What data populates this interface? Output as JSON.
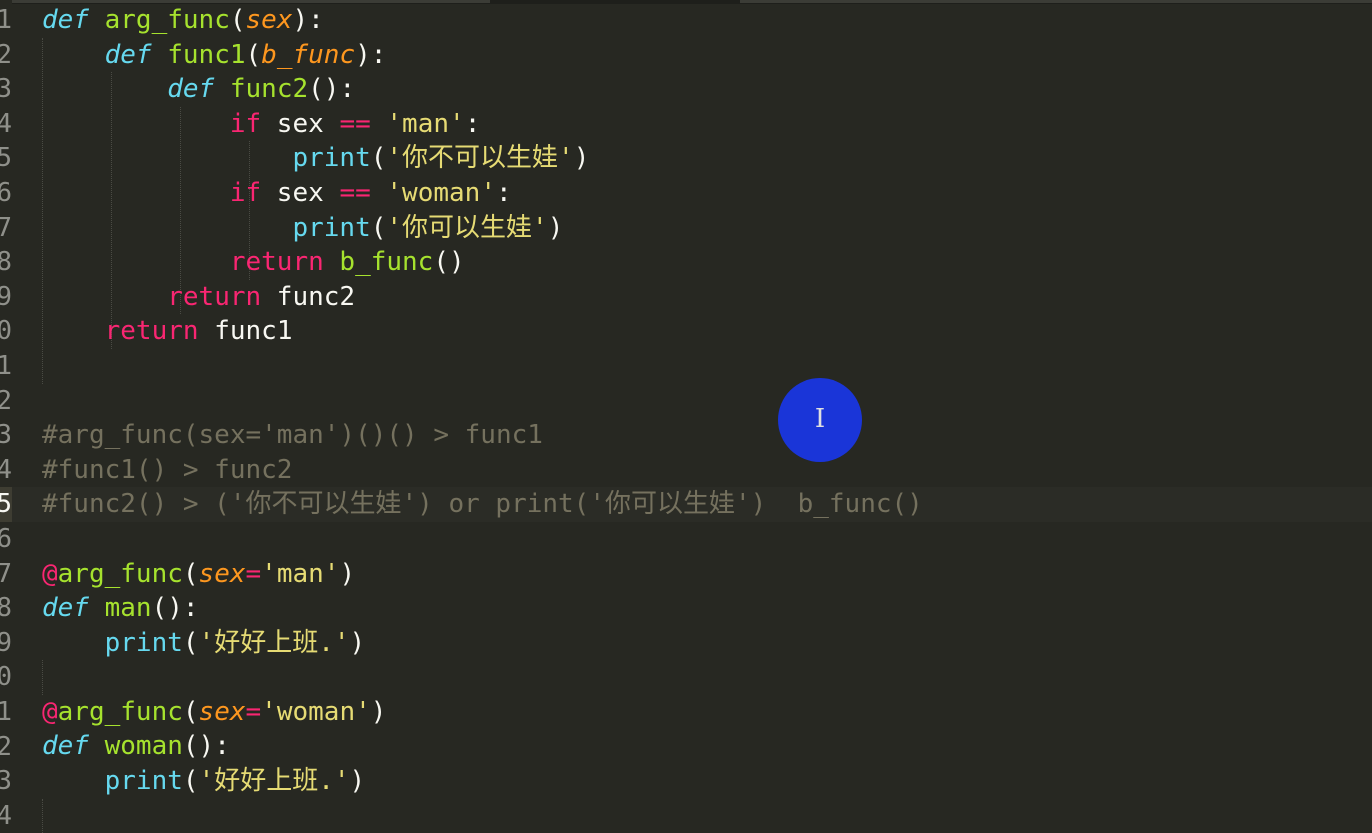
{
  "editor": {
    "active_line": 15,
    "line_numbers": [
      "1",
      "2",
      "3",
      "4",
      "5",
      "6",
      "7",
      "8",
      "9",
      "0",
      "1",
      "2",
      "3",
      "4",
      "5",
      "6",
      "7",
      "8",
      "9",
      "0",
      "1",
      "2",
      "3",
      "4"
    ],
    "lines": [
      [
        {
          "t": "def",
          "c": "kw-def"
        },
        {
          "t": " ",
          "c": "plain"
        },
        {
          "t": "arg_func",
          "c": "fn"
        },
        {
          "t": "(",
          "c": "plain"
        },
        {
          "t": "sex",
          "c": "param"
        },
        {
          "t": "):",
          "c": "plain"
        }
      ],
      [
        {
          "t": "    ",
          "c": "plain"
        },
        {
          "t": "def",
          "c": "kw-def"
        },
        {
          "t": " ",
          "c": "plain"
        },
        {
          "t": "func1",
          "c": "fn"
        },
        {
          "t": "(",
          "c": "plain"
        },
        {
          "t": "b_func",
          "c": "param"
        },
        {
          "t": "):",
          "c": "plain"
        }
      ],
      [
        {
          "t": "        ",
          "c": "plain"
        },
        {
          "t": "def",
          "c": "kw-def"
        },
        {
          "t": " ",
          "c": "plain"
        },
        {
          "t": "func2",
          "c": "fn"
        },
        {
          "t": "():",
          "c": "plain"
        }
      ],
      [
        {
          "t": "            ",
          "c": "plain"
        },
        {
          "t": "if",
          "c": "kw"
        },
        {
          "t": " sex ",
          "c": "plain"
        },
        {
          "t": "==",
          "c": "op"
        },
        {
          "t": " ",
          "c": "plain"
        },
        {
          "t": "'man'",
          "c": "str"
        },
        {
          "t": ":",
          "c": "plain"
        }
      ],
      [
        {
          "t": "                ",
          "c": "plain"
        },
        {
          "t": "print",
          "c": "bi"
        },
        {
          "t": "(",
          "c": "plain"
        },
        {
          "t": "'你不可以生娃'",
          "c": "str"
        },
        {
          "t": ")",
          "c": "plain"
        }
      ],
      [
        {
          "t": "            ",
          "c": "plain"
        },
        {
          "t": "if",
          "c": "kw"
        },
        {
          "t": " sex ",
          "c": "plain"
        },
        {
          "t": "==",
          "c": "op"
        },
        {
          "t": " ",
          "c": "plain"
        },
        {
          "t": "'woman'",
          "c": "str"
        },
        {
          "t": ":",
          "c": "plain"
        }
      ],
      [
        {
          "t": "                ",
          "c": "plain"
        },
        {
          "t": "print",
          "c": "bi"
        },
        {
          "t": "(",
          "c": "plain"
        },
        {
          "t": "'你可以生娃'",
          "c": "str"
        },
        {
          "t": ")",
          "c": "plain"
        }
      ],
      [
        {
          "t": "            ",
          "c": "plain"
        },
        {
          "t": "return",
          "c": "kw"
        },
        {
          "t": " b_func",
          "c": "fn"
        },
        {
          "t": "()",
          "c": "plain"
        }
      ],
      [
        {
          "t": "        ",
          "c": "plain"
        },
        {
          "t": "return",
          "c": "kw"
        },
        {
          "t": " func2",
          "c": "plain"
        }
      ],
      [
        {
          "t": "    ",
          "c": "plain"
        },
        {
          "t": "return",
          "c": "kw"
        },
        {
          "t": " func1",
          "c": "plain"
        }
      ],
      [],
      [],
      [
        {
          "t": "#arg_func(sex='man')()() > func1",
          "c": "cmt"
        }
      ],
      [
        {
          "t": "#func1() > func2",
          "c": "cmt"
        }
      ],
      [
        {
          "t": "#func2() > ('你不可以生娃') or print('你可以生娃')  b_func()",
          "c": "cmt"
        }
      ],
      [],
      [
        {
          "t": "@",
          "c": "kw"
        },
        {
          "t": "arg_func",
          "c": "fn"
        },
        {
          "t": "(",
          "c": "plain"
        },
        {
          "t": "sex",
          "c": "param"
        },
        {
          "t": "=",
          "c": "op"
        },
        {
          "t": "'man'",
          "c": "str"
        },
        {
          "t": ")",
          "c": "plain"
        }
      ],
      [
        {
          "t": "def",
          "c": "kw-def"
        },
        {
          "t": " ",
          "c": "plain"
        },
        {
          "t": "man",
          "c": "fn"
        },
        {
          "t": "():",
          "c": "plain"
        }
      ],
      [
        {
          "t": "    ",
          "c": "plain"
        },
        {
          "t": "print",
          "c": "bi"
        },
        {
          "t": "(",
          "c": "plain"
        },
        {
          "t": "'好好上班.'",
          "c": "str"
        },
        {
          "t": ")",
          "c": "plain"
        }
      ],
      [],
      [
        {
          "t": "@",
          "c": "kw"
        },
        {
          "t": "arg_func",
          "c": "fn"
        },
        {
          "t": "(",
          "c": "plain"
        },
        {
          "t": "sex",
          "c": "param"
        },
        {
          "t": "=",
          "c": "op"
        },
        {
          "t": "'woman'",
          "c": "str"
        },
        {
          "t": ")",
          "c": "plain"
        }
      ],
      [
        {
          "t": "def",
          "c": "kw-def"
        },
        {
          "t": " ",
          "c": "plain"
        },
        {
          "t": "woman",
          "c": "fn"
        },
        {
          "t": "():",
          "c": "plain"
        }
      ],
      [
        {
          "t": "    ",
          "c": "plain"
        },
        {
          "t": "print",
          "c": "bi"
        },
        {
          "t": "(",
          "c": "plain"
        },
        {
          "t": "'好好上班.'",
          "c": "str"
        },
        {
          "t": ")",
          "c": "plain"
        }
      ],
      []
    ]
  },
  "cursor": {
    "icon": "i-beam-cursor-icon",
    "highlight_color": "#1a35d8",
    "glyph": "I"
  }
}
